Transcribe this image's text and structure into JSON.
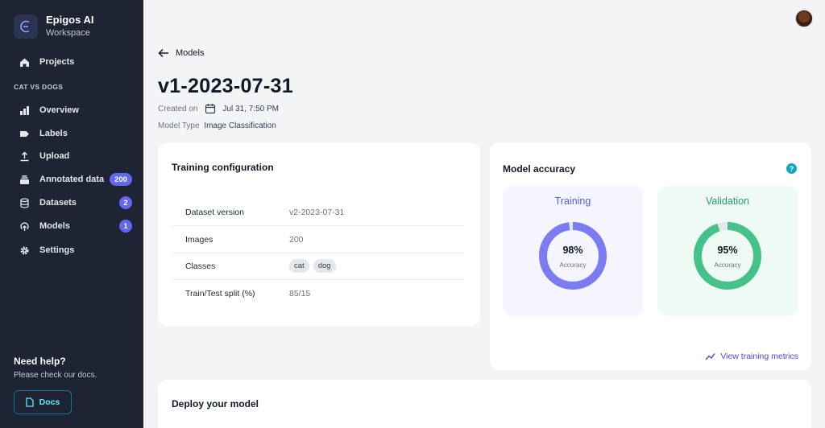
{
  "brand": {
    "name": "Epigos AI",
    "workspace": "Workspace"
  },
  "nav": {
    "projects": "Projects",
    "section": "CAT VS DOGS",
    "items": [
      {
        "label": "Overview",
        "icon": "bar-chart-icon"
      },
      {
        "label": "Labels",
        "icon": "tag-icon"
      },
      {
        "label": "Upload",
        "icon": "upload-icon"
      },
      {
        "label": "Annotated data",
        "icon": "stack-icon",
        "badge": "200"
      },
      {
        "label": "Datasets",
        "icon": "database-icon",
        "badge": "2"
      },
      {
        "label": "Models",
        "icon": "model-icon",
        "badge": "1"
      },
      {
        "label": "Settings",
        "icon": "gear-icon"
      }
    ]
  },
  "help": {
    "title": "Need help?",
    "subtitle": "Please check our docs.",
    "docs_label": "Docs"
  },
  "header": {
    "back_label": "Models",
    "title": "v1-2023-07-31",
    "created_label": "Created on",
    "created_value": "Jul 31, 7:50 PM",
    "type_label": "Model Type",
    "type_value": "Image Classification"
  },
  "training_config": {
    "title": "Training configuration",
    "rows": [
      {
        "label": "Dataset version",
        "value": "v2-2023-07-31"
      },
      {
        "label": "Images",
        "value": "200"
      },
      {
        "label": "Classes",
        "chips": [
          "cat",
          "dog"
        ]
      },
      {
        "label": "Train/Test split (%)",
        "value": "85/15"
      }
    ]
  },
  "accuracy": {
    "title": "Model accuracy",
    "training": {
      "label": "Training",
      "value": 98,
      "display": "98%",
      "sub": "Accuracy",
      "color": "#7c7cf2",
      "bg": "#f5f5ff",
      "label_color": "#5b5bd6"
    },
    "validation": {
      "label": "Validation",
      "value": 95,
      "display": "95%",
      "sub": "Accuracy",
      "color": "#45c28a",
      "bg": "#eefaf3",
      "label_color": "#22a06b"
    },
    "metrics_link": "View training metrics"
  },
  "deploy": {
    "title": "Deploy your model"
  }
}
